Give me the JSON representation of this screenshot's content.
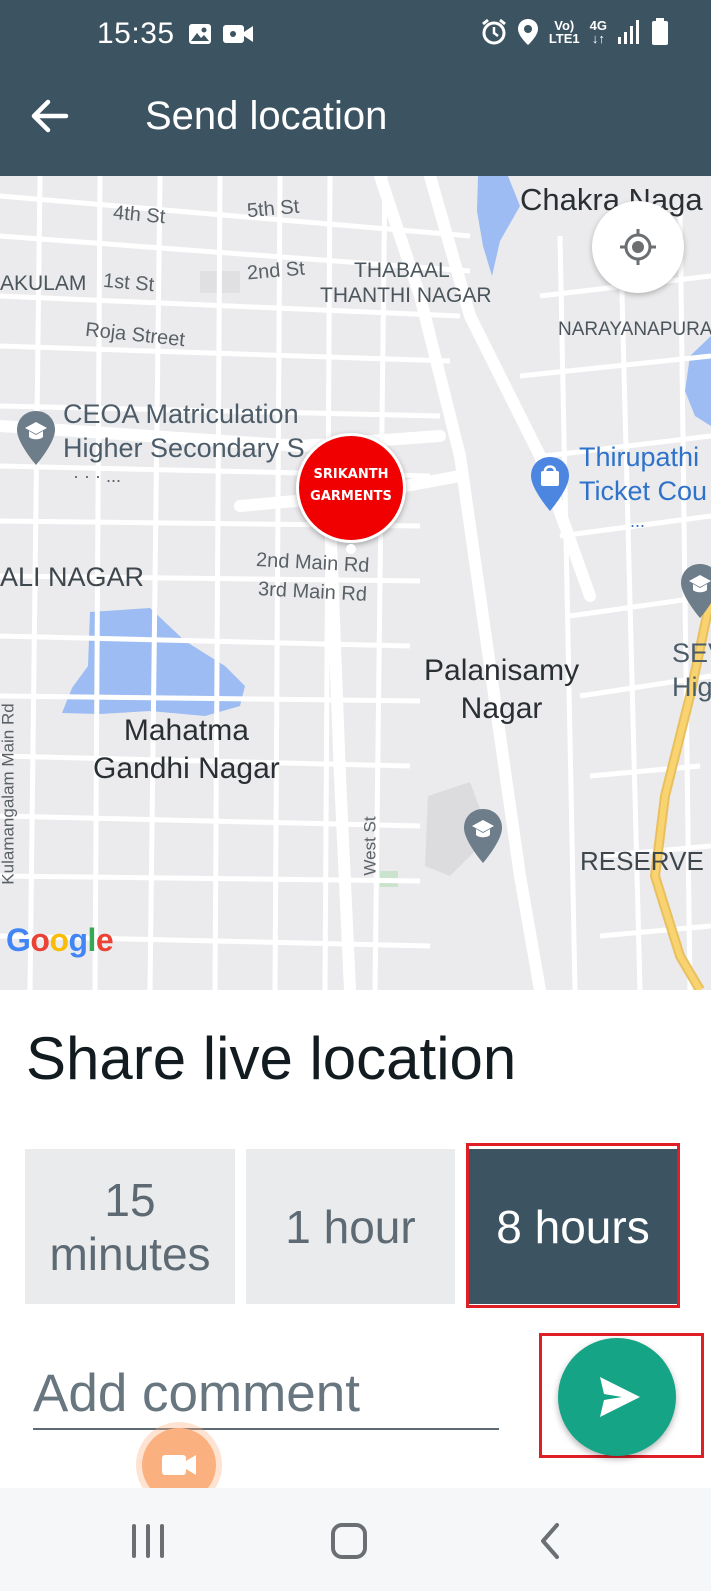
{
  "status_bar": {
    "time": "15:35",
    "icons_left": [
      "image-icon",
      "video-camera-icon"
    ],
    "icons_right": [
      "alarm-icon",
      "location-pin-icon",
      "volte-icon",
      "4g-icon",
      "signal-icon",
      "battery-icon"
    ],
    "volte_line1": "Vo)",
    "volte_line2": "LTE1",
    "network_label": "4G"
  },
  "header": {
    "title": "Send location",
    "back_icon": "arrow-left-icon"
  },
  "map": {
    "labels": {
      "chakra": "Chakra Naga",
      "st4": "4th St",
      "st5": "5th St",
      "akulam": "AKULAM",
      "st1": "1st St",
      "st2": "2nd St",
      "thabaal": "THABAAL",
      "thanthi": "THANTHI NAGAR",
      "roja": "Roja Street",
      "narayanapura": "NARAYANAPURA",
      "ceoa1": "CEOA Matriculation",
      "ceoa2": "Higher Secondary S",
      "ceoa3": "· · · ...",
      "thiru1": "Thirupathi",
      "thiru2": "Ticket Cou",
      "thiru3": "...",
      "ali": "ALI NAGAR",
      "main2": "2nd Main Rd",
      "main3": "3rd Main Rd",
      "palani": "Palanisamy\nNagar",
      "sev": "SEV",
      "hig": "Hig",
      "mahatma": "Mahatma\nGandhi Nagar",
      "kula": "Kulamangalam Main Rd",
      "west": "West St",
      "reserve": "RESERVE L"
    },
    "pin_label_1": "SRIKANTH",
    "pin_label_2": "GARMENTS",
    "google": [
      "G",
      "o",
      "o",
      "g",
      "l",
      "e"
    ],
    "colors": {
      "water": "#9cbcf3",
      "road": "#ffffff",
      "highway": "#f8d36f",
      "poi_icon": "#6e7d8a",
      "shop_icon": "#4c86e0"
    }
  },
  "share": {
    "title": "Share live location",
    "options": [
      {
        "line1": "15",
        "line2": "minutes"
      },
      {
        "line1": "1 hour"
      },
      {
        "line1": "8 hours"
      }
    ],
    "selected": "8 hours",
    "comment_placeholder": "Add comment",
    "send_icon": "send-icon",
    "accent": "#15a486",
    "selected_bg": "#3c5362",
    "highlight": "#e01e26"
  },
  "nav_bar": {
    "buttons": [
      "recent-apps-icon",
      "home-icon",
      "back-icon"
    ]
  }
}
